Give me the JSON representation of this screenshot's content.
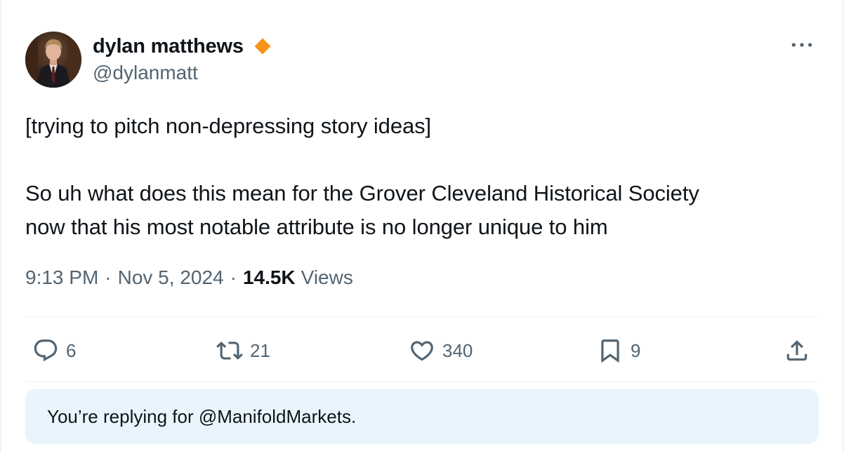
{
  "author": {
    "display_name": "dylan matthews",
    "handle": "@dylanmatt",
    "verified_badge_color": "#f7931a"
  },
  "tweet": {
    "text_lines": [
      "[trying to pitch non-depressing story ideas]",
      "So uh what does this mean for the Grover Cleveland Historical Society",
      "now that his most notable attribute is no longer unique to him"
    ]
  },
  "meta": {
    "time": "9:13 PM",
    "separator": "·",
    "date": "Nov 5, 2024",
    "views_count": "14.5K",
    "views_label": "Views"
  },
  "actions": {
    "replies": "6",
    "reposts": "21",
    "likes": "340",
    "bookmarks": "9"
  },
  "reply_banner": {
    "text": "You’re replying for @ManifoldMarkets."
  },
  "icons": {
    "more": "more-horizontal-icon",
    "reply": "reply-icon",
    "repost": "repost-icon",
    "like": "heart-icon",
    "bookmark": "bookmark-icon",
    "share": "share-icon",
    "verified": "verified-badge-icon"
  },
  "colors": {
    "text_primary": "#0f1419",
    "text_secondary": "#536471",
    "banner_bg": "#e8f5fd"
  }
}
